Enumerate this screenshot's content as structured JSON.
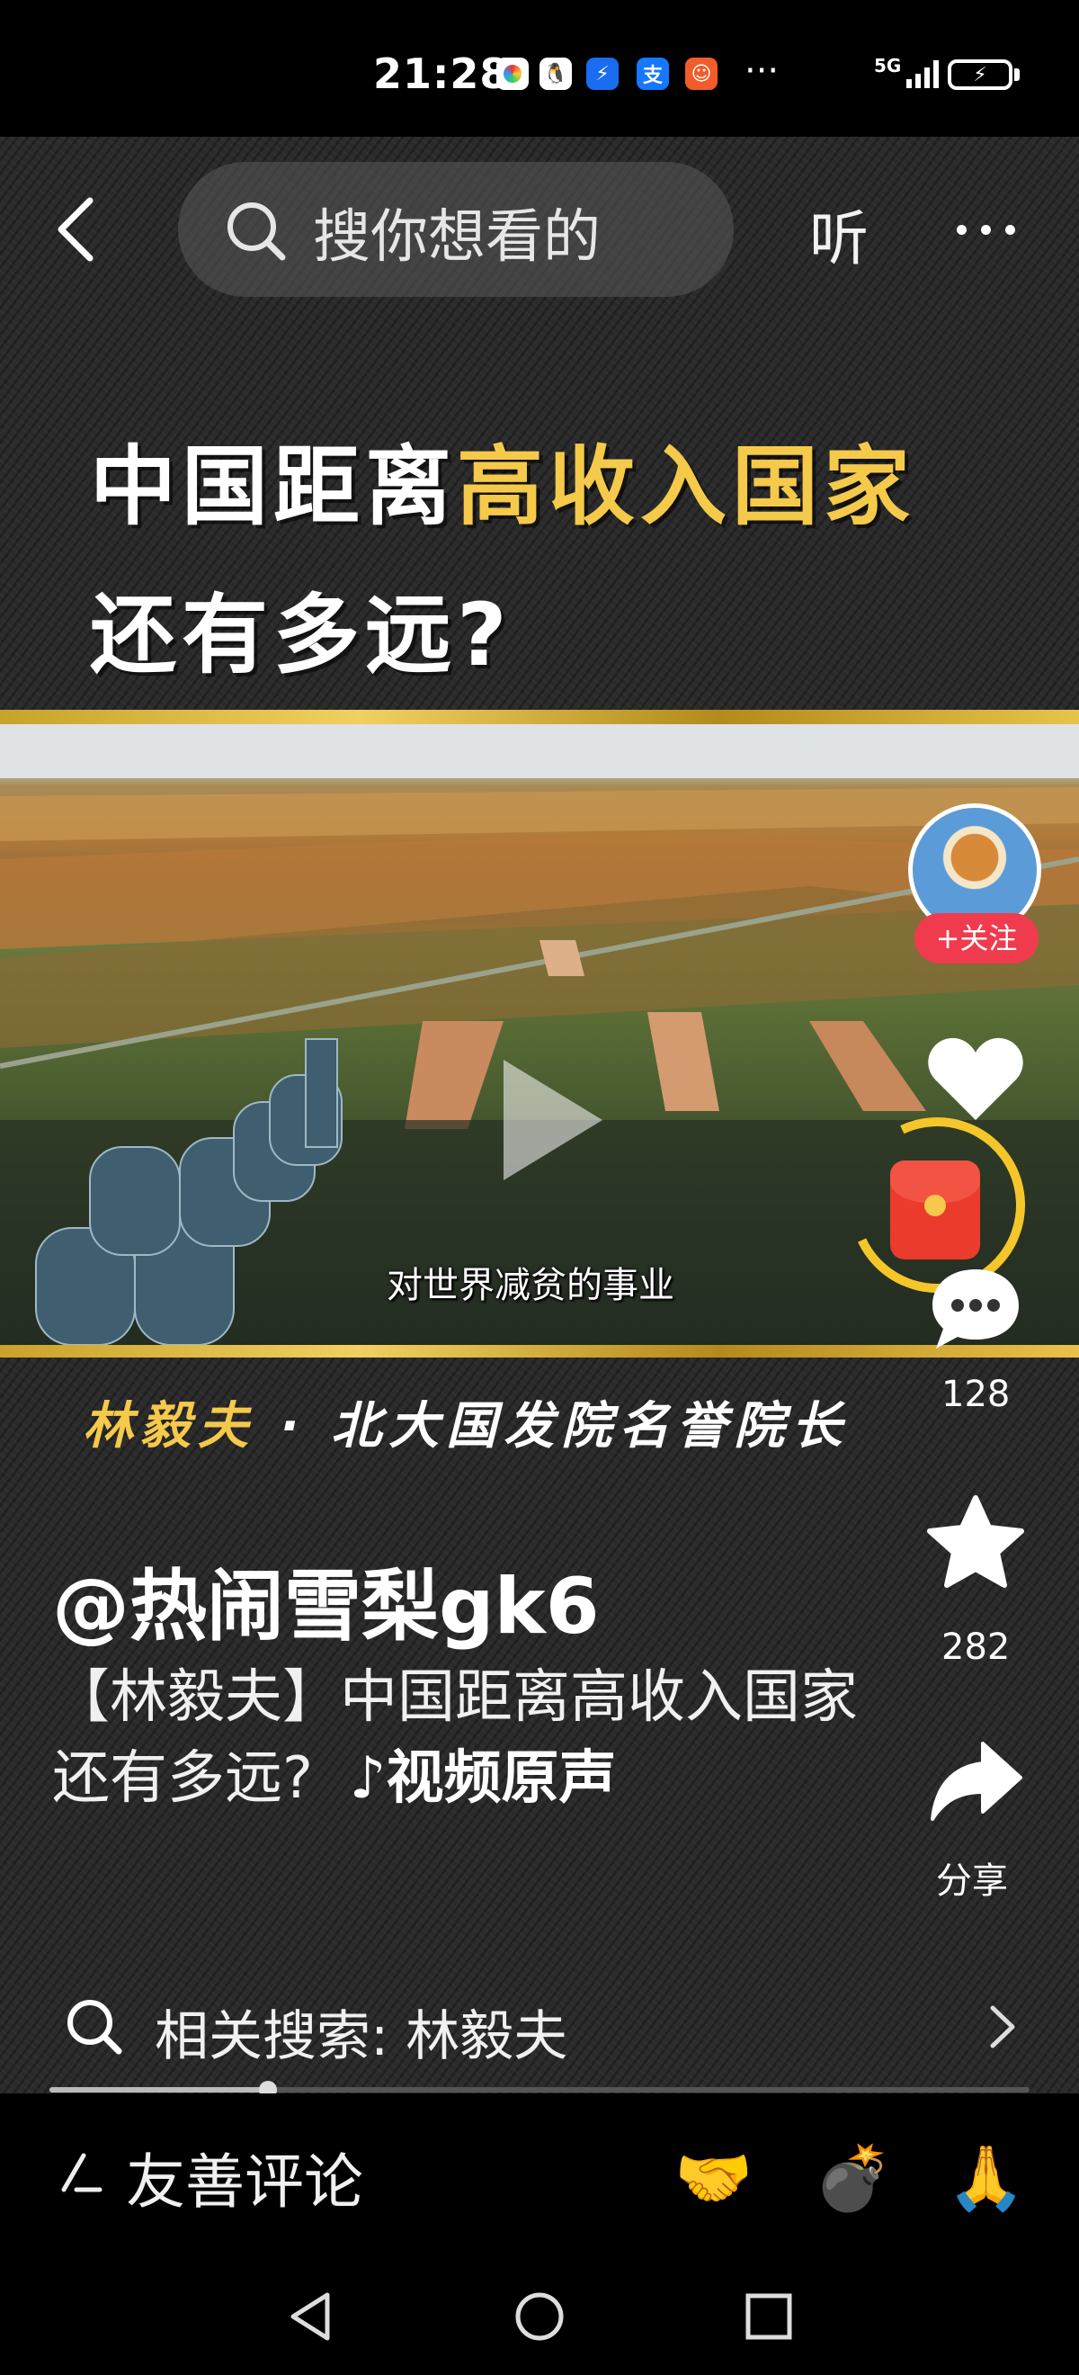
{
  "status_bar": {
    "time": "21:28",
    "more": "···",
    "network": "5G",
    "battery_symbol": "⚡"
  },
  "top_nav": {
    "search_placeholder": "搜你想看的",
    "listen_label": "听"
  },
  "video": {
    "headline_white_1": "中国距离",
    "headline_gold_1": "高收入国家",
    "headline_line_2": "还有多远?",
    "subtitle": "对世界减贫的事业",
    "byline_name": "林毅夫",
    "byline_sep": "·",
    "byline_title": "北大国发院名誉院长"
  },
  "right_rail": {
    "follow_label": "+关注",
    "comment_count": "128",
    "favorite_count": "282",
    "share_label": "分享"
  },
  "post": {
    "author": "@热闹雪梨gk6",
    "description": "【林毅夫】中国距离高收入国家还有多远?",
    "music_note": "♪",
    "music_label": "视频原声"
  },
  "related": {
    "label": "相关搜索: 林毅夫"
  },
  "comment_bar": {
    "placeholder": "友善评论",
    "emojis": [
      "🤝",
      "💣",
      "🙏"
    ]
  },
  "colors": {
    "gold": "#f5c94a",
    "follow_red": "#f03b4e",
    "redpacket": "#ea3b2c"
  }
}
